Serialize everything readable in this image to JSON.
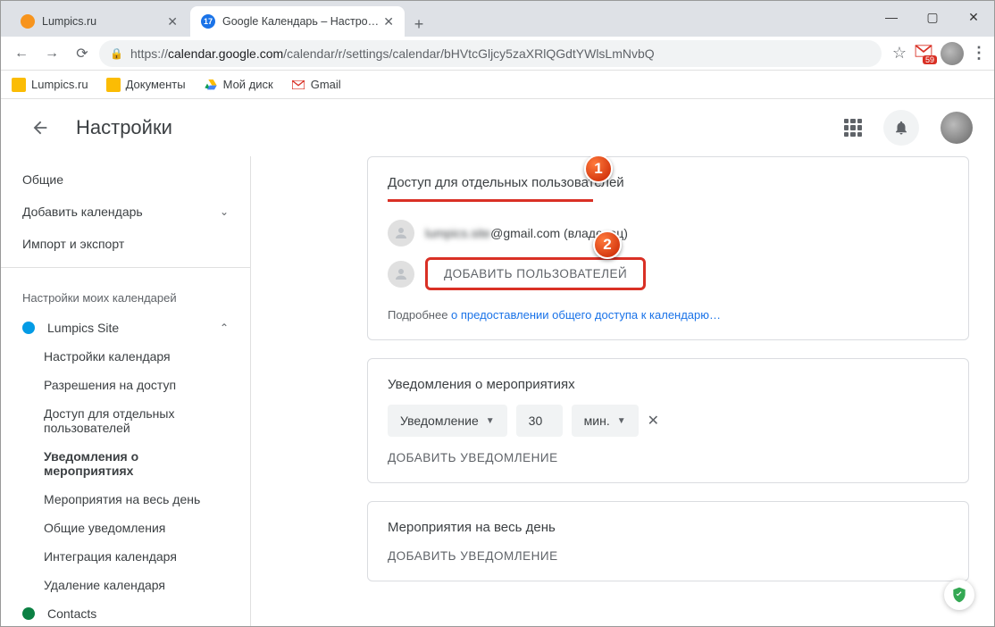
{
  "window": {
    "min": "—",
    "max": "▢",
    "close": "✕"
  },
  "tabs": [
    {
      "title": "Lumpics.ru",
      "favicon": "#f7941d"
    },
    {
      "title": "Google Календарь – Настройки",
      "favicon": "#1a73e8",
      "active": true
    }
  ],
  "url": {
    "lock": "🔒",
    "prefix": "https://",
    "domain": "calendar.google.com",
    "path": "/calendar/r/settings/calendar/bHVtcGljcy5zaXRlQGdtYWlsLmNvbQ"
  },
  "addr_icons": {
    "gmail_count": "59"
  },
  "bookmarks": [
    {
      "label": "Lumpics.ru",
      "color": "#fbbc04"
    },
    {
      "label": "Документы",
      "color": "#fbbc04"
    },
    {
      "label": "Мой диск",
      "color": "drive"
    },
    {
      "label": "Gmail",
      "color": "gmail"
    }
  ],
  "header": {
    "title": "Настройки"
  },
  "sidebar": {
    "top": [
      {
        "label": "Общие"
      },
      {
        "label": "Добавить календарь",
        "dropdown": true
      },
      {
        "label": "Импорт и экспорт"
      }
    ],
    "section_label": "Настройки моих календарей",
    "calendar": {
      "name": "Lumpics Site",
      "color": "#039be5",
      "expanded": true
    },
    "subs": [
      {
        "label": "Настройки календаря"
      },
      {
        "label": "Разрешения на доступ"
      },
      {
        "label": "Доступ для отдельных пользователей"
      },
      {
        "label": "Уведомления о мероприятиях",
        "active": true
      },
      {
        "label": "Мероприятия на весь день"
      },
      {
        "label": "Общие уведомления"
      },
      {
        "label": "Интеграция календаря"
      },
      {
        "label": "Удаление календаря"
      }
    ],
    "calendar2": {
      "name": "Contacts",
      "color": "#0b8043"
    }
  },
  "access": {
    "title": "Доступ для отдельных пользователей",
    "owner_email_blurred": "lumpics.site",
    "owner_email_domain": "@gmail.com (владелец)",
    "add_button": "ДОБАВИТЬ ПОЛЬЗОВАТЕЛЕЙ",
    "more_prefix": "Подробнее ",
    "more_link": "о предоставлении общего доступа к календарю…"
  },
  "notifications": {
    "title": "Уведомления о мероприятиях",
    "type": "Уведомление",
    "value": "30",
    "unit": "мин.",
    "add": "ДОБАВИТЬ УВЕДОМЛЕНИЕ"
  },
  "allday": {
    "title": "Мероприятия на весь день",
    "add": "ДОБАВИТЬ УВЕДОМЛЕНИЕ"
  },
  "callouts": {
    "c1": "1",
    "c2": "2"
  }
}
